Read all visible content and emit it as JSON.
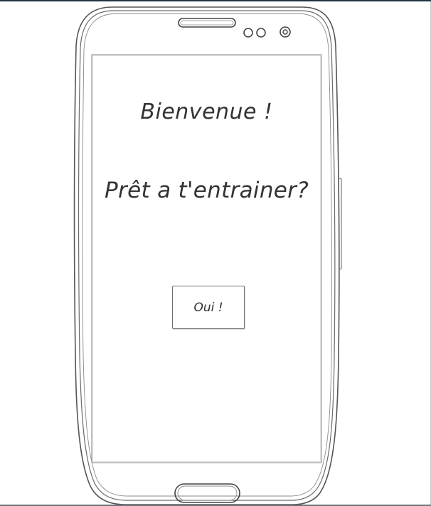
{
  "screen": {
    "welcome_text": "Bienvenue !",
    "question_text": "Prêt a t'entrainer?",
    "yes_button_label": "Oui !"
  },
  "phone": {
    "speaker_icon": "speaker-grille-icon",
    "sensor_icon": "proximity-sensor-icon",
    "camera_icon": "front-camera-icon",
    "home_icon": "home-button-icon"
  },
  "colors": {
    "outline": "#555555",
    "text": "#333333",
    "top_bar": "#1f3440"
  }
}
